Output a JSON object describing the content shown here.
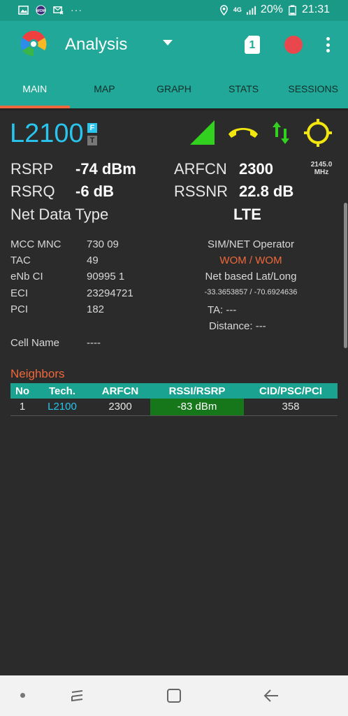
{
  "status_bar": {
    "icons": [
      "gallery-icon",
      "wom-app-icon",
      "mail-blocked-icon"
    ],
    "more": "···",
    "network": "4G",
    "battery_pct": "20%",
    "time": "21:31"
  },
  "app_bar": {
    "title": "Analysis",
    "sim_slot": "1",
    "colors": {
      "bar": "#22a898",
      "status": "#1a9986",
      "record": "#e8484d"
    }
  },
  "tabs": [
    {
      "label": "MAIN",
      "active": true
    },
    {
      "label": "MAP",
      "active": false
    },
    {
      "label": "GRAPH",
      "active": false
    },
    {
      "label": "STATS",
      "active": false
    },
    {
      "label": "SESSIONS",
      "active": false
    }
  ],
  "cell": {
    "tech": "L2100",
    "tag_f": "F",
    "tag_t": "T",
    "rsrp_label": "RSRP",
    "rsrp_value": "-74 dBm",
    "rsrq_label": "RSRQ",
    "rsrq_value": "-6 dB",
    "arfcn_label": "ARFCN",
    "arfcn_value": "2300",
    "freq_mhz": "2145.0",
    "freq_unit": "MHz",
    "rssnr_label": "RSSNR",
    "rssnr_value": "22.8 dB",
    "net_type_label": "Net Data Type",
    "net_type_value": "LTE"
  },
  "details": {
    "mcc_mnc_label": "MCC MNC",
    "mcc_mnc_value": "730 09",
    "tac_label": "TAC",
    "tac_value": "49",
    "enb_label": "eNb CI",
    "enb_value": "90995 1",
    "eci_label": "ECI",
    "eci_value": "23294721",
    "pci_label": "PCI",
    "pci_value": "182",
    "cell_name_label": "Cell Name",
    "cell_name_value": "----",
    "operator_label": "SIM/NET Operator",
    "operator_value": "WOM / WOM",
    "latlong_label": "Net based Lat/Long",
    "latlong_value": "-33.3653857 / -70.6924636",
    "ta_label": "TA: ---",
    "distance_label": "Distance: ---"
  },
  "neighbors": {
    "title": "Neighbors",
    "headers": [
      "No",
      "Tech.",
      "ARFCN",
      "RSSI/RSRP",
      "CID/PSC/PCI"
    ],
    "rows": [
      {
        "no": "1",
        "tech": "L2100",
        "arfcn": "2300",
        "rssi": "-83 dBm",
        "cid": "358"
      }
    ]
  }
}
